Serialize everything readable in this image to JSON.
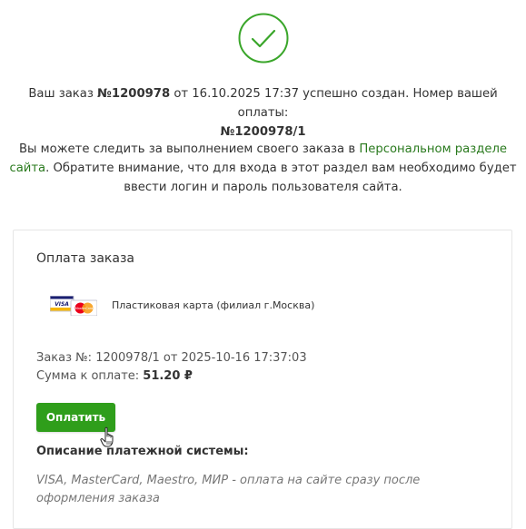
{
  "confirmation": {
    "prefix": "Ваш заказ ",
    "order_number": "№1200978",
    "middle": " от 16.10.2025 17:37 успешно создан. Номер вашей оплаты:",
    "payment_number": "№1200978/1"
  },
  "tracking": {
    "before_link": "Вы можете следить за выполнением своего заказа в ",
    "link_label": "Персональном разделе сайта",
    "after_link": ". Обратите внимание, что для входа в этот раздел вам необходимо будет ввести логин и пароль пользователя сайта."
  },
  "payment": {
    "title": "Оплата заказа",
    "card_logo_icon": "visa-mastercard-icon",
    "method_name": "Пластиковая карта (филиал г.Москва)",
    "order_line": "Заказ №: 1200978/1 от 2025-10-16 17:37:03",
    "sum_label": "Сумма к оплате: ",
    "sum_value": "51.20 ₽",
    "pay_button_label": "Оплатить",
    "description_title": "Описание платежной системы:",
    "description_text": "VISA, MasterCard, Maestro, МИР -  оплата на сайте сразу после оформления заказа"
  },
  "colors": {
    "accent": "#2f9e1b",
    "link": "#2a7a1e",
    "check": "#3aa62a"
  }
}
